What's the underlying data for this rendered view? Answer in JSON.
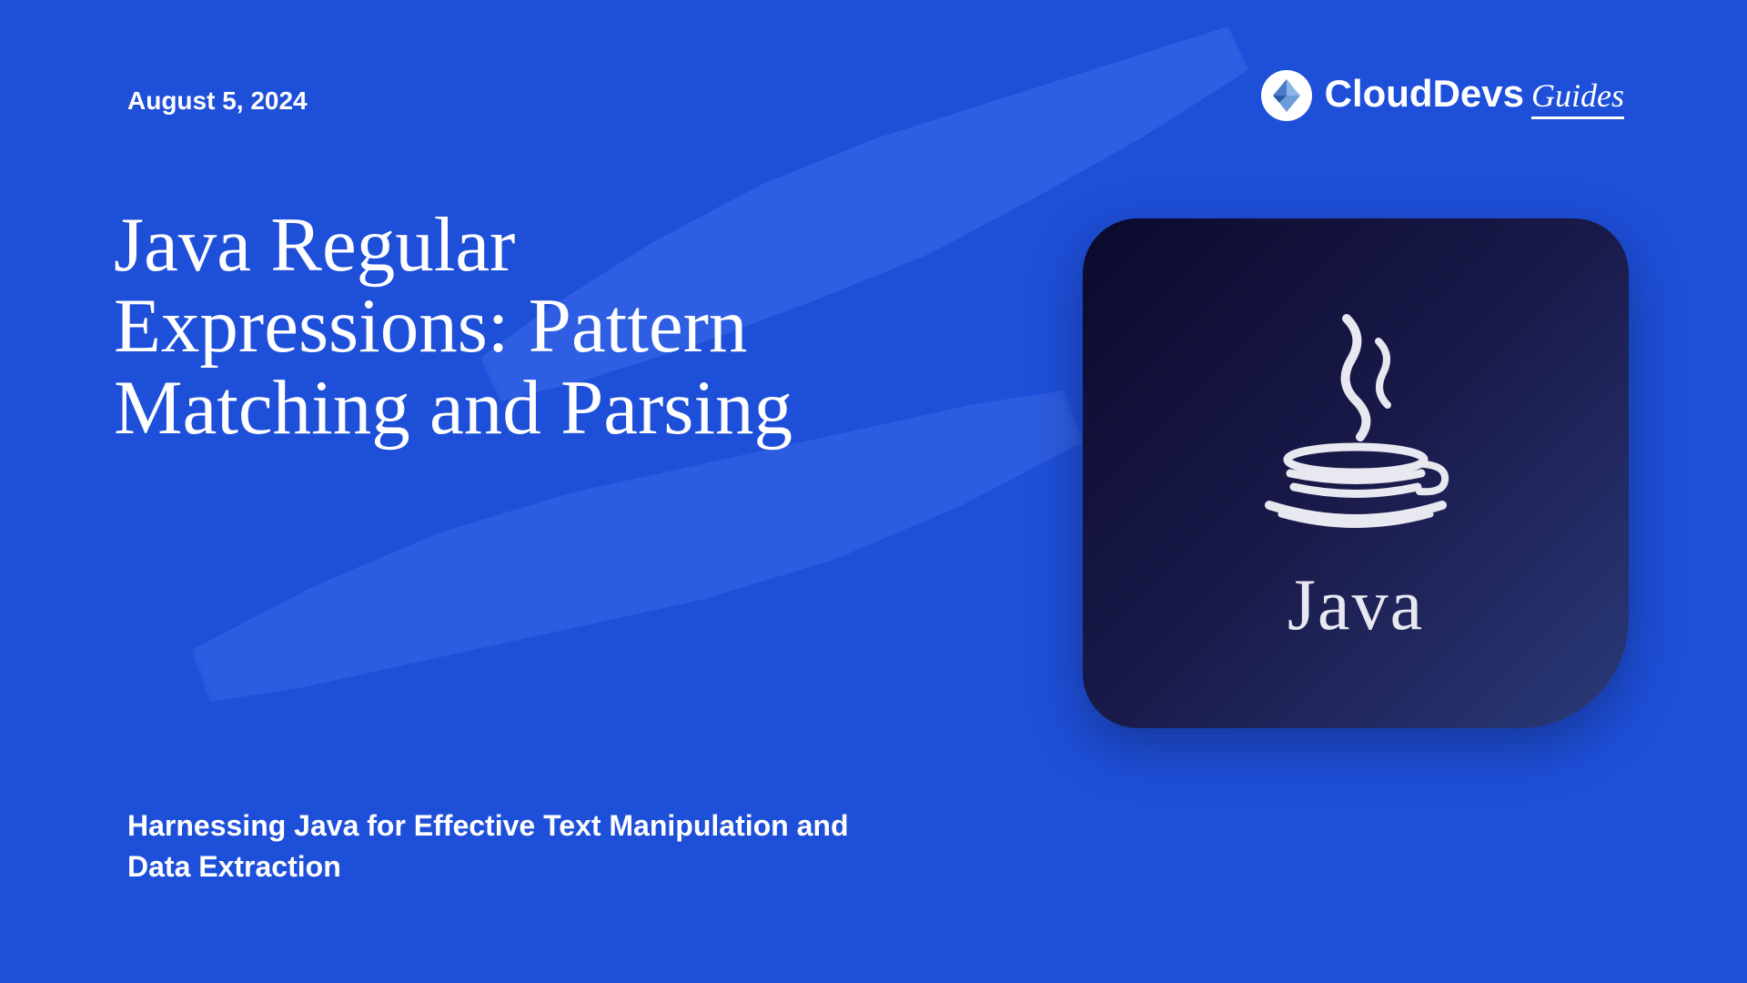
{
  "date": "August 5, 2024",
  "brand": {
    "name": "CloudDevs",
    "suffix": "Guides"
  },
  "title": "Java Regular Expressions: Pattern Matching and Parsing",
  "subtitle": "Harnessing Java for Effective Text Manipulation and Data Extraction",
  "logo": {
    "text": "Java"
  }
}
